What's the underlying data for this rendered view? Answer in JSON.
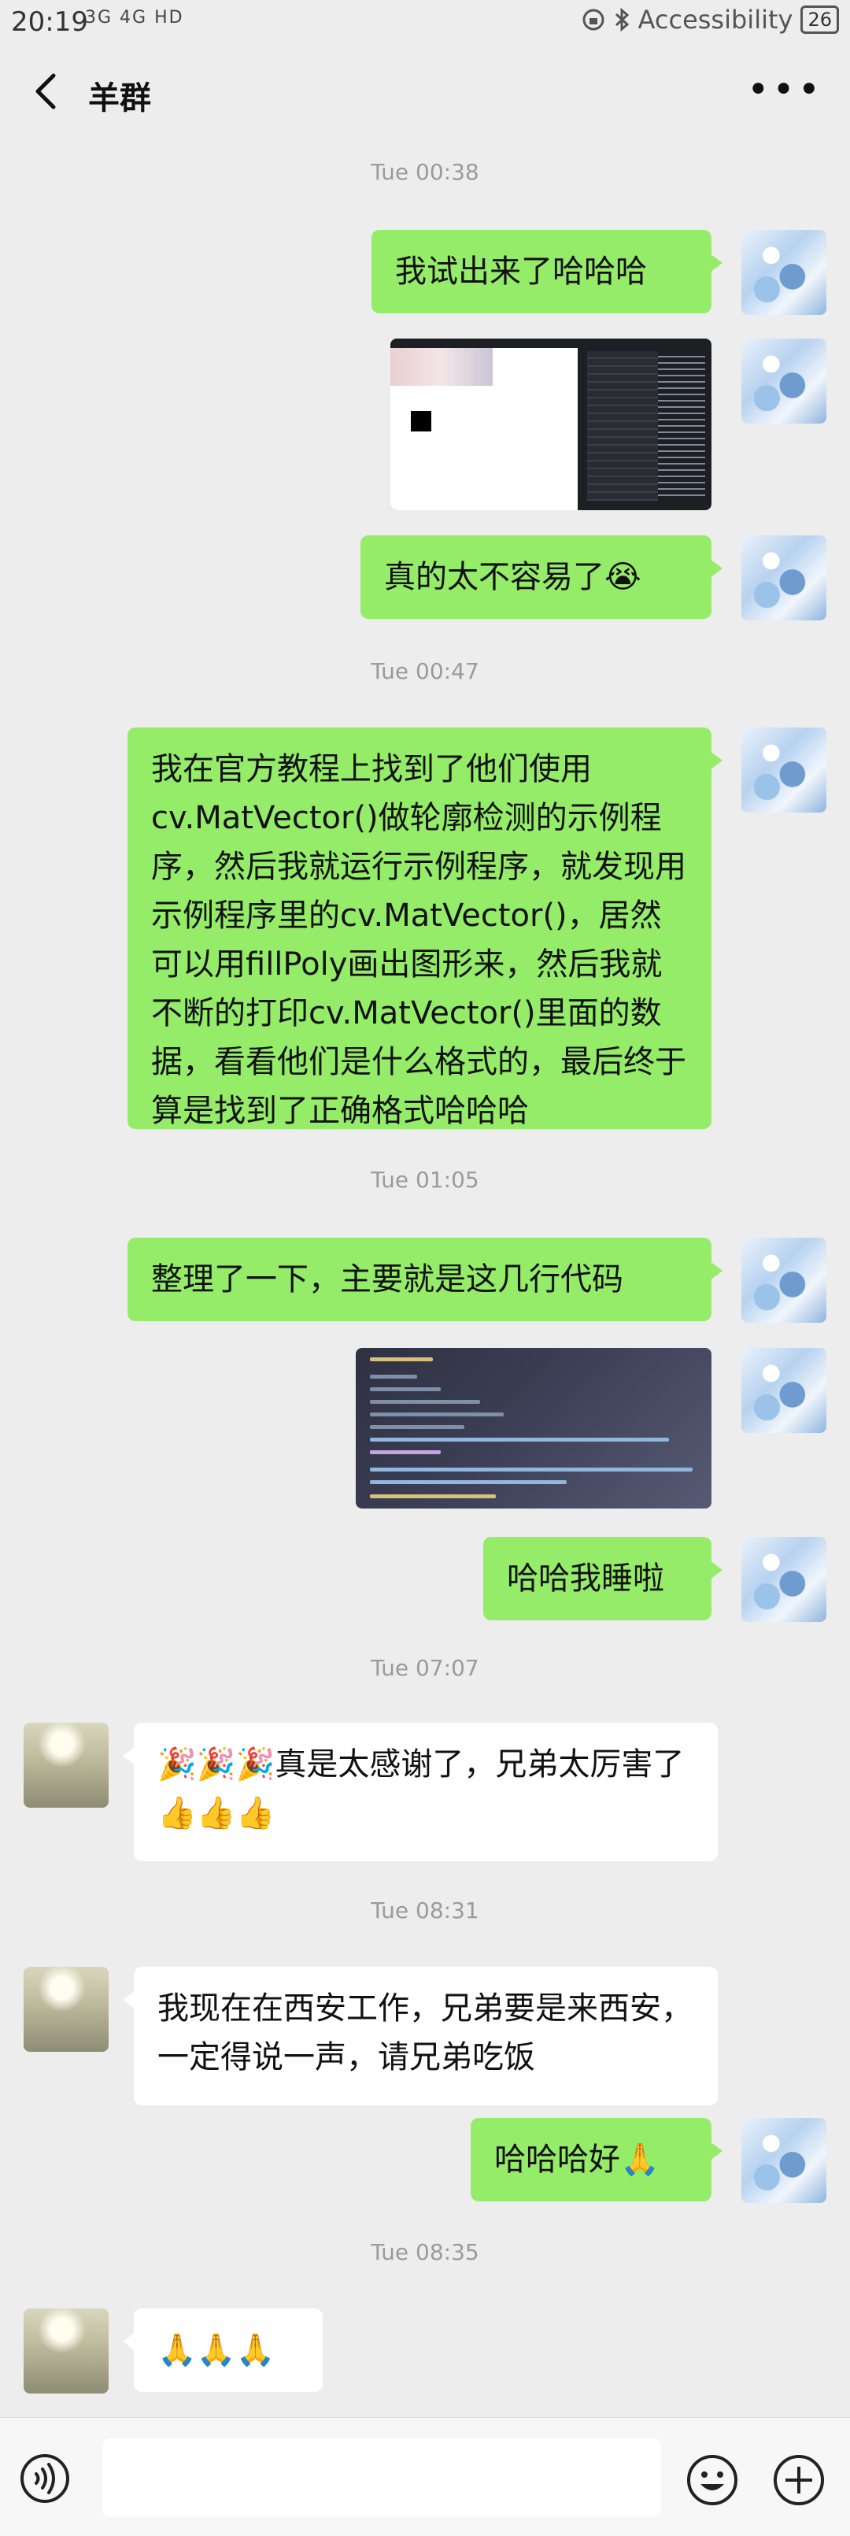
{
  "status_bar": {
    "time": "20:19",
    "signals": "3G 4G HD",
    "accessibility": "Accessibility",
    "battery": "26"
  },
  "header": {
    "title": "羊群",
    "back_icon": "chevron-left-icon",
    "more_icon": "more-dots-icon"
  },
  "messages": {
    "ts1": "Tue 00:38",
    "m1": "我试出来了哈哈哈",
    "m3": "真的太不容易了😭",
    "ts2": "Tue 00:47",
    "m4": "我在官方教程上找到了他们使用cv.MatVector()做轮廓检测的示例程序，然后我就运行示例程序，就发现用示例程序里的cv.MatVector()，居然可以用fillPoly画出图形来，然后我就不断的打印cv.MatVector()里面的数据，看看他们是什么格式的，最后终于算是找到了正确格式哈哈哈",
    "ts3": "Tue 01:05",
    "m5": "整理了一下，主要就是这几行代码",
    "m7": "哈哈我睡啦",
    "ts4": "Tue 07:07",
    "m8": "🎉🎉🎉真是太感谢了，兄弟太厉害了👍👍👍",
    "ts5": "Tue 08:31",
    "m9": "我现在在西安工作，兄弟要是来西安，一定得说一声，请兄弟吃饭",
    "m10": "哈哈哈好🙏",
    "ts6": "Tue 08:35",
    "m11": "🙏🙏🙏"
  },
  "input_bar": {
    "voice_icon": "voice-icon",
    "emoji_icon": "emoji-icon",
    "plus_icon": "plus-icon"
  },
  "colors": {
    "my_bubble": "#95ec69",
    "other_bubble": "#ffffff",
    "background": "#ededed"
  }
}
